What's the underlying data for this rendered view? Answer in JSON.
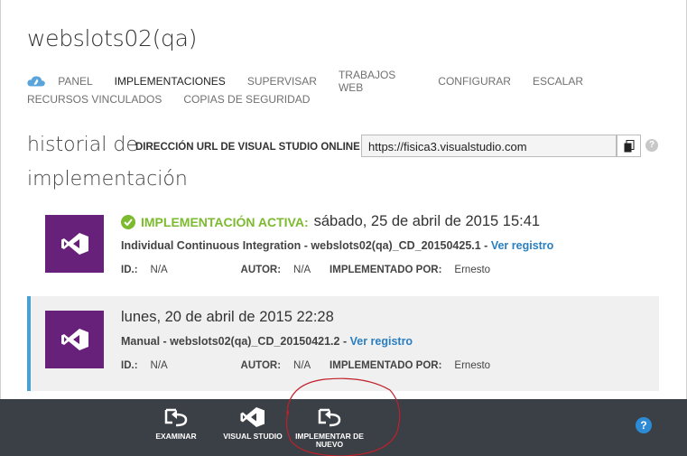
{
  "page": {
    "title": "webslots02(qa)"
  },
  "nav": {
    "row1": [
      "PANEL",
      "IMPLEMENTACIONES",
      "SUPERVISAR",
      "TRABAJOS WEB",
      "CONFIGURAR",
      "ESCALAR"
    ],
    "row2": [
      "RECURSOS VINCULADOS",
      "COPIAS DE SEGURIDAD"
    ],
    "active": "IMPLEMENTACIONES"
  },
  "history": {
    "title_line1": "historial de",
    "title_line2": "implementación",
    "url_label": "DIRECCIÓN URL DE VISUAL STUDIO ONLINE",
    "url_value": "https://fisica3.visualstudio.com"
  },
  "deployments": [
    {
      "status": "IMPLEMENTACIÓN ACTIVA:",
      "date": "sábado, 25 de abril de 2015 15:41",
      "description": "Individual Continuous Integration - webslots02(qa)_CD_20150425.1 -",
      "link": "Ver registro",
      "id_label": "ID.:",
      "id_value": "N/A",
      "author_label": "AUTOR:",
      "author_value": "N/A",
      "deployed_by_label": "IMPLEMENTADO POR:",
      "deployed_by_value": "Ernesto"
    },
    {
      "date": "lunes, 20 de abril de 2015 22:28",
      "description": "Manual - webslots02(qa)_CD_20150421.2 -",
      "link": "Ver registro",
      "id_label": "ID.:",
      "id_value": "N/A",
      "author_label": "AUTOR:",
      "author_value": "N/A",
      "deployed_by_label": "IMPLEMENTADO POR:",
      "deployed_by_value": "Ernesto"
    }
  ],
  "commandbar": {
    "examinar": "EXAMINAR",
    "visual_studio": "VISUAL STUDIO",
    "redeploy_line1": "IMPLEMENTAR DE",
    "redeploy_line2": "NUEVO",
    "help": "?"
  },
  "colors": {
    "accent_blue": "#2a7fc1",
    "active_green": "#7cba2f",
    "vs_purple": "#68217a",
    "cmdbar": "#3b3f46",
    "annotation_red": "#c0202a"
  }
}
